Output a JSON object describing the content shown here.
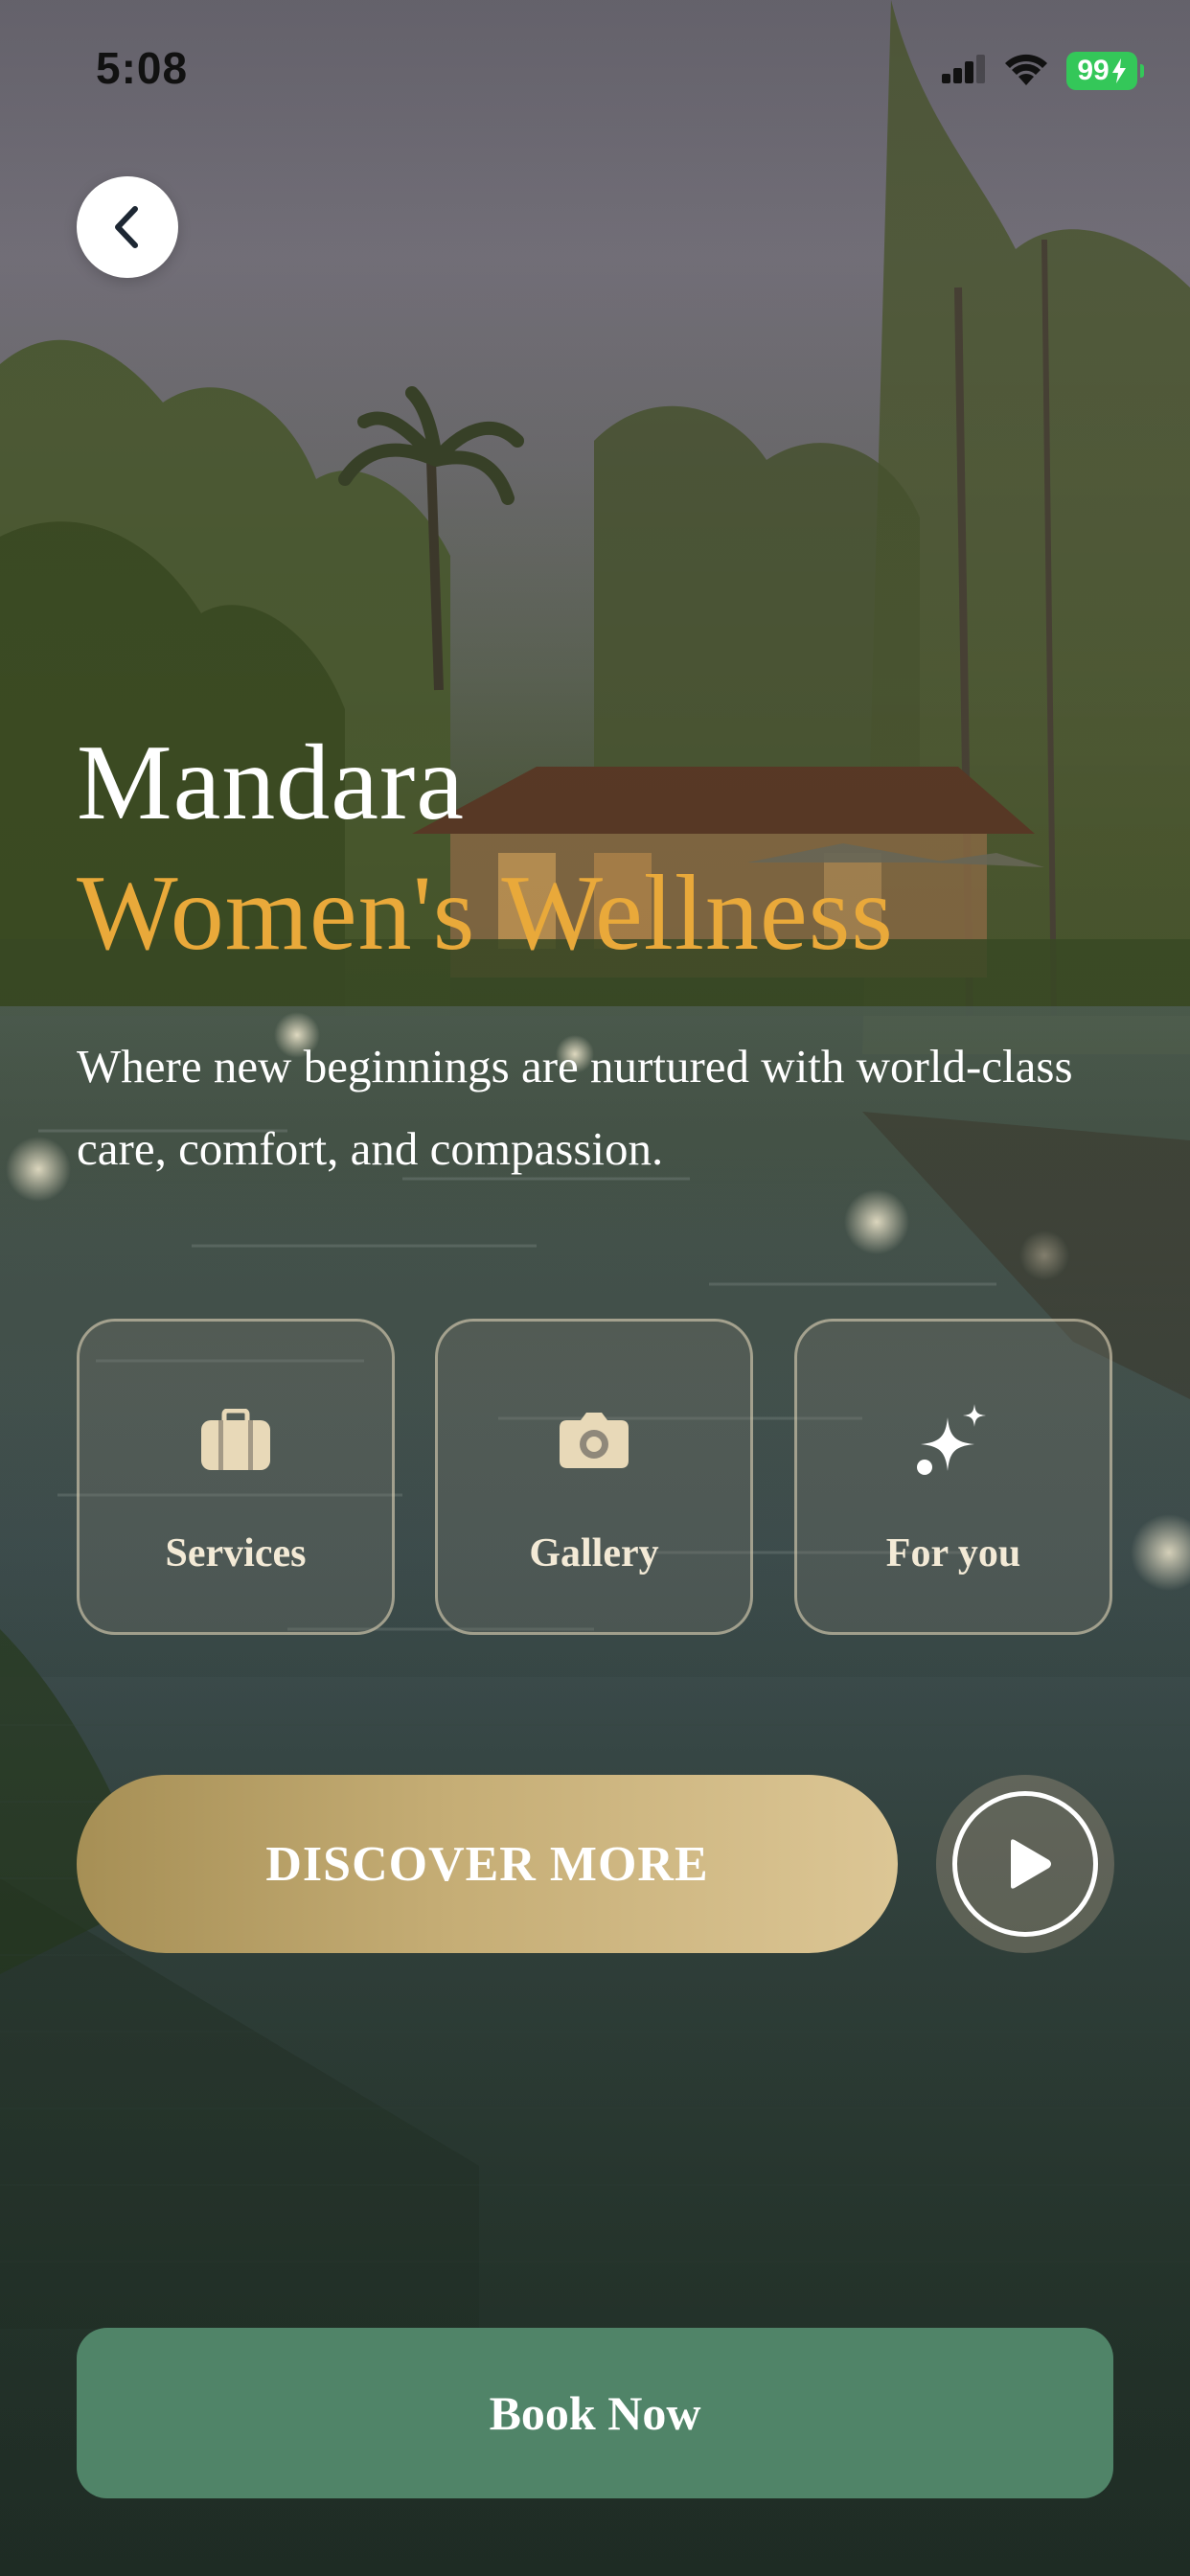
{
  "status_bar": {
    "time": "5:08",
    "battery_level": "99",
    "battery_charging": true,
    "icons": [
      "signal-icon",
      "wifi-icon",
      "battery-icon"
    ]
  },
  "navigation": {
    "back_icon": "chevron-left-icon"
  },
  "hero": {
    "title_line1": "Mandara",
    "title_line2": "Women's Wellness",
    "subtitle": "Where new beginnings are nurtured with world-class care, comfort, and compassion."
  },
  "features": [
    {
      "label": "Services",
      "icon": "briefcase-icon"
    },
    {
      "label": "Gallery",
      "icon": "camera-icon"
    },
    {
      "label": "For you",
      "icon": "sparkle-icon"
    }
  ],
  "actions": {
    "discover_label": "DISCOVER MORE",
    "play_icon": "play-icon",
    "book_label": "Book Now"
  },
  "colors": {
    "title_primary": "#ffffff",
    "title_accent": "#e9a93a",
    "card_text": "#f3ead6",
    "discover_gradient_start": "#a68f55",
    "discover_gradient_end": "#dcc695",
    "book_button": "#508468",
    "battery": "#34c759"
  }
}
